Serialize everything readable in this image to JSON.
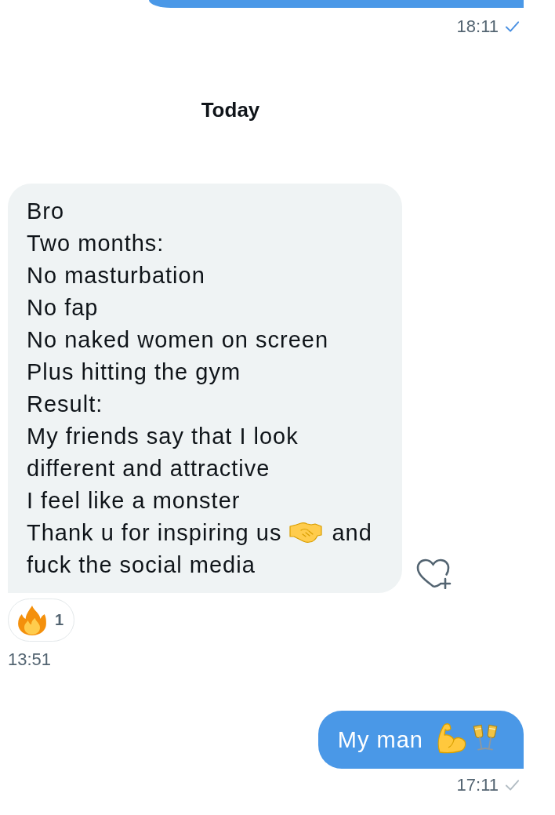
{
  "conversation": [
    {
      "kind": "sent",
      "cut_off": true,
      "time": "18:11",
      "read": true
    },
    {
      "kind": "day",
      "label": "Today"
    },
    {
      "kind": "received",
      "lines": [
        [
          "Bro"
        ],
        [
          "Two months:"
        ],
        [
          "No masturbation"
        ],
        [
          "No fap"
        ],
        [
          "No naked women on screen"
        ],
        [
          "Plus hitting the gym"
        ],
        [
          "Result:"
        ],
        [
          "My friends say that I look different and attractive"
        ],
        [
          "I feel like a monster"
        ],
        [
          "Thank u for inspiring us",
          {
            "kind": "handshake"
          },
          "and"
        ],
        [
          "fuck the social media"
        ]
      ],
      "reactions": [
        {
          "kind": "fire",
          "count": "1"
        }
      ],
      "time": "13:51"
    },
    {
      "kind": "sent",
      "lines": [
        [
          "My man",
          {
            "kind": "biceps"
          },
          {
            "kind": "glasses"
          }
        ]
      ],
      "time": "17:11",
      "read": false
    }
  ]
}
